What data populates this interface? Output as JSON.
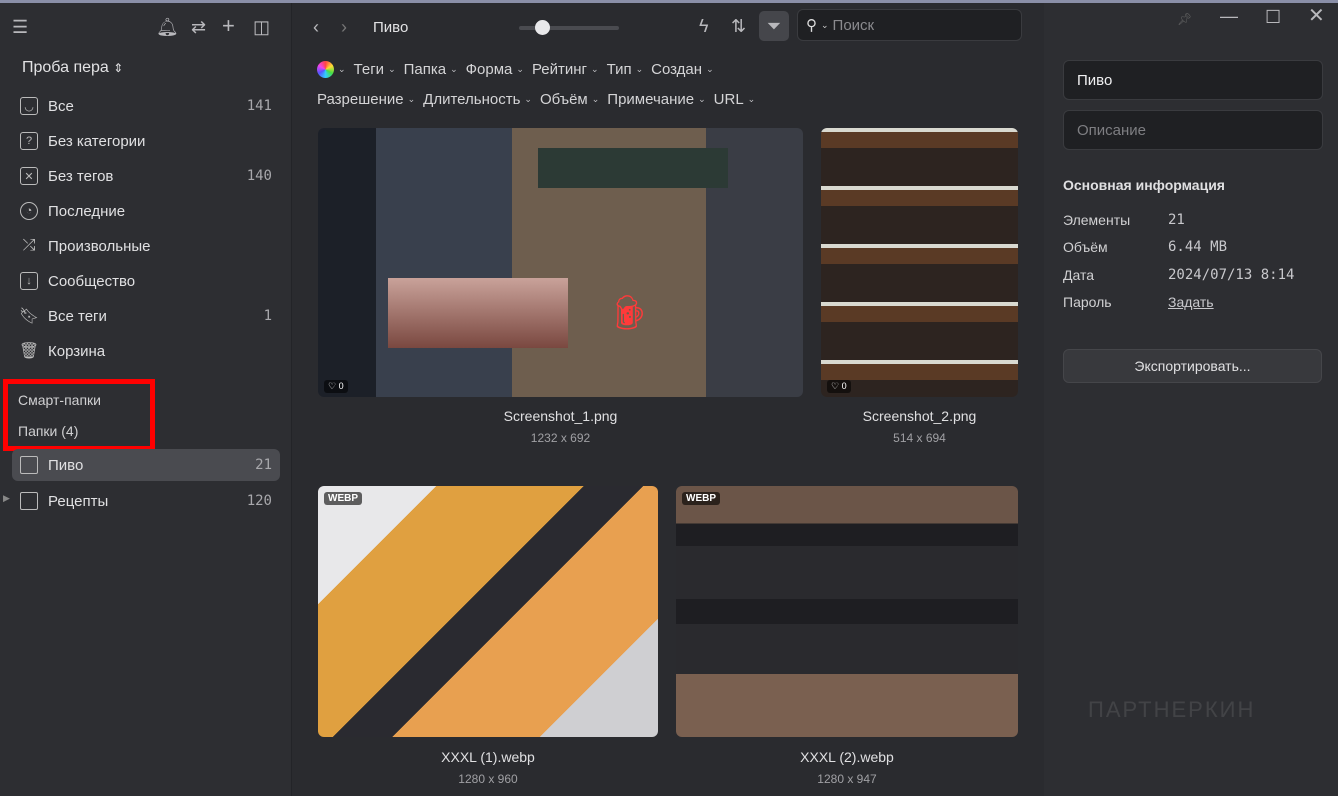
{
  "sidebar": {
    "workspace": "Проба пера",
    "items": [
      {
        "label": "Все",
        "count": "141",
        "icon": "inbox-icon"
      },
      {
        "label": "Без категории",
        "count": "",
        "icon": "question-icon"
      },
      {
        "label": "Без тегов",
        "count": "140",
        "icon": "untagged-icon"
      },
      {
        "label": "Последние",
        "count": "",
        "icon": "clock-icon"
      },
      {
        "label": "Произвольные",
        "count": "",
        "icon": "shuffle-icon"
      },
      {
        "label": "Сообщество",
        "count": "",
        "icon": "download-box-icon"
      },
      {
        "label": "Все теги",
        "count": "1",
        "icon": "bookmark-icon"
      },
      {
        "label": "Корзина",
        "count": "",
        "icon": "trash-icon"
      }
    ],
    "smart_folders": "Смарт-папки",
    "folders_header": "Папки (4)",
    "folders": [
      {
        "label": "Пиво",
        "count": "21"
      },
      {
        "label": "Рецепты",
        "count": "120"
      }
    ]
  },
  "toolbar": {
    "breadcrumb": "Пиво",
    "search_placeholder": "Поиск",
    "zoom_level": 0.2
  },
  "filters": {
    "row1": [
      "Теги",
      "Папка",
      "Форма",
      "Рейтинг",
      "Тип",
      "Создан"
    ],
    "row2": [
      "Разрешение",
      "Длительность",
      "Объём",
      "Примечание",
      "URL"
    ]
  },
  "items": [
    {
      "name": "Screenshot_1.png",
      "dims": "1232 x 692",
      "likes": "0",
      "badge": ""
    },
    {
      "name": "Screenshot_2.png",
      "dims": "514 x 694",
      "likes": "0",
      "badge": ""
    },
    {
      "name": "XXXL (1).webp",
      "dims": "1280 x 960",
      "badge": "WEBP"
    },
    {
      "name": "XXXL (2).webp",
      "dims": "1280 x 947",
      "badge": "WEBP"
    }
  ],
  "details": {
    "name": "Пиво",
    "description_placeholder": "Описание",
    "section": "Основная информация",
    "rows": [
      {
        "label": "Элементы",
        "value": "21"
      },
      {
        "label": "Объём",
        "value": "6.44 MB"
      },
      {
        "label": "Дата",
        "value": "2024/07/13 8:14"
      },
      {
        "label": "Пароль",
        "value": "Задать"
      }
    ],
    "export": "Экспортировать..."
  },
  "watermark": "ПАРТНЕРКИН"
}
